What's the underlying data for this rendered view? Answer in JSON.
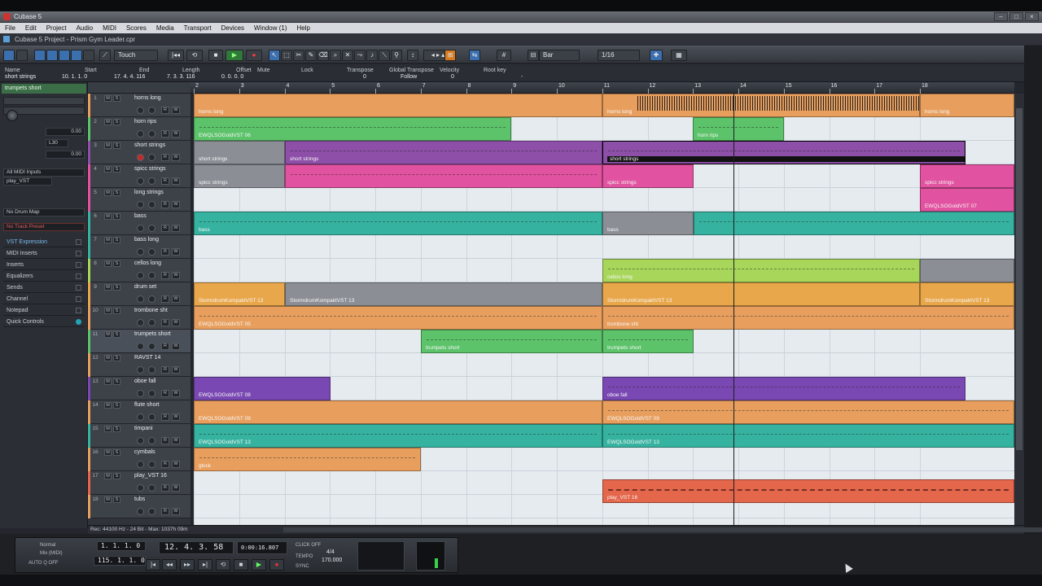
{
  "window": {
    "title": "Cubase 5",
    "project_title": "Cubase 5 Project - Prism Gym Leader.cpr"
  },
  "menu": [
    "File",
    "Edit",
    "Project",
    "Audio",
    "MIDI",
    "Scores",
    "Media",
    "Transport",
    "Devices",
    "Window (1)",
    "Help"
  ],
  "toolbar": {
    "automation_mode": "Touch",
    "snap_type": "Bar",
    "quantize": "1/16"
  },
  "info_line": {
    "labels": [
      "Name",
      "Start",
      "End",
      "Length",
      "Offset",
      "Mute",
      "Lock",
      "Transpose",
      "Global Transpose",
      "Velocity",
      "Root key"
    ],
    "name_value": "short strings",
    "start_value": "10. 1. 1.   0",
    "end_value": "17. 4. 4. 116",
    "length_value": "7. 3. 3. 116",
    "offset_value": "0. 0. 0.   0",
    "transpose_value": "0",
    "global_transpose_value": "Follow",
    "velocity_value": "0",
    "rootkey_value": "-"
  },
  "inspector": {
    "track_title": "trumpets short",
    "volume_value": "0.00",
    "pan_value": "L30",
    "transpose_value": "0.00",
    "input": "All MIDI Inputs",
    "output": "play_VST",
    "drum_map": "No Drum Map",
    "track_preset": "No Track Preset",
    "sections": [
      "VST Expression",
      "MIDI Inserts",
      "Inserts",
      "Equalizers",
      "Sends",
      "Channel",
      "Notepad",
      "Quick Controls"
    ]
  },
  "ruler": {
    "bars": [
      "2",
      "3",
      "4",
      "5",
      "6",
      "7",
      "8",
      "9",
      "10",
      "11",
      "12",
      "13",
      "14",
      "15",
      "16",
      "17",
      "18"
    ]
  },
  "tracks": [
    {
      "num": "1",
      "name": "horns long",
      "color": "#e89f5e"
    },
    {
      "num": "2",
      "name": "horn rips",
      "color": "#5cc36a"
    },
    {
      "num": "3",
      "name": "short strings",
      "color": "#8d4fa8"
    },
    {
      "num": "4",
      "name": "spicc strings",
      "color": "#e153a0"
    },
    {
      "num": "5",
      "name": "long strings",
      "color": "#e153a0"
    },
    {
      "num": "6",
      "name": "bass",
      "color": "#36b3a0"
    },
    {
      "num": "7",
      "name": "bass long",
      "color": "#36b3a0"
    },
    {
      "num": "8",
      "name": "cellos long",
      "color": "#a8d65a"
    },
    {
      "num": "9",
      "name": "drum set",
      "color": "#e9a74b"
    },
    {
      "num": "10",
      "name": "trombone sht",
      "color": "#e89f5e"
    },
    {
      "num": "11",
      "name": "trumpets short",
      "color": "#5cc36a"
    },
    {
      "num": "12",
      "name": "RAVST 14",
      "color": "#e89f5e"
    },
    {
      "num": "13",
      "name": "oboe fall",
      "color": "#7a48b3"
    },
    {
      "num": "14",
      "name": "flute short",
      "color": "#e89f5e"
    },
    {
      "num": "15",
      "name": "timpani",
      "color": "#36b3a0"
    },
    {
      "num": "16",
      "name": "cymbals",
      "color": "#e89f5e"
    },
    {
      "num": "17",
      "name": "play_VST 16",
      "color": "#e4664b"
    },
    {
      "num": "18",
      "name": "tubs",
      "color": "#e89f5e"
    }
  ],
  "parts": {
    "p1a": "horns long",
    "p1b": "horns long",
    "p1c": "horns long",
    "p2a": "EWQLSOGoldVST 06",
    "p2b": "horn rips",
    "p3a": "short strings",
    "p3b": "short strings",
    "p3c": "short strings",
    "p4a": "spicc strings",
    "p4b": "spicc strings",
    "p4c": "spicc strings",
    "p5a": "EWQLSOGoldVST 07",
    "p6a": "bass",
    "p6b": "bass",
    "p8a": "cellos long",
    "p9a": "StormdrumKompaktVST 13",
    "p9b": "StormdrumKompaktVST 13",
    "p9c": "StormdrumKompaktVST 13",
    "p9d": "StormdrumKompaktVST 13",
    "p10a": "EWQLSOGoldVST 05",
    "p10b": "trombone sht",
    "p11a": "trumpets short",
    "p11b": "trumpets short",
    "p13a": "EWQLSOGoldVST 08",
    "p13b": "oboe fall",
    "p14a": "EWQLSOGoldVST 09",
    "p14b": "EWQLSOGoldVST 09",
    "p15a": "EWQLSOGoldVST 13",
    "p15b": "EWQLSOGoldVST 13",
    "p16a": "glock",
    "p17a": "play_VST 16"
  },
  "status_bar": "Rec: 44100 Hz - 24 Bit - Max: 1037h 09m",
  "transport": {
    "mode": "Normal",
    "mix": "Mix (MIDI)",
    "auto_q": "AUTO Q OFF",
    "left_locator": "1. 1. 1.   0",
    "right_locator": "115. 1. 1.   0",
    "position": "12. 4. 3. 58",
    "time": "0:00:16.807",
    "click": "CLICK OFF",
    "tempo_label": "TEMPO",
    "tempo": "170.000",
    "signature": "4/4",
    "sync": "SYNC"
  }
}
